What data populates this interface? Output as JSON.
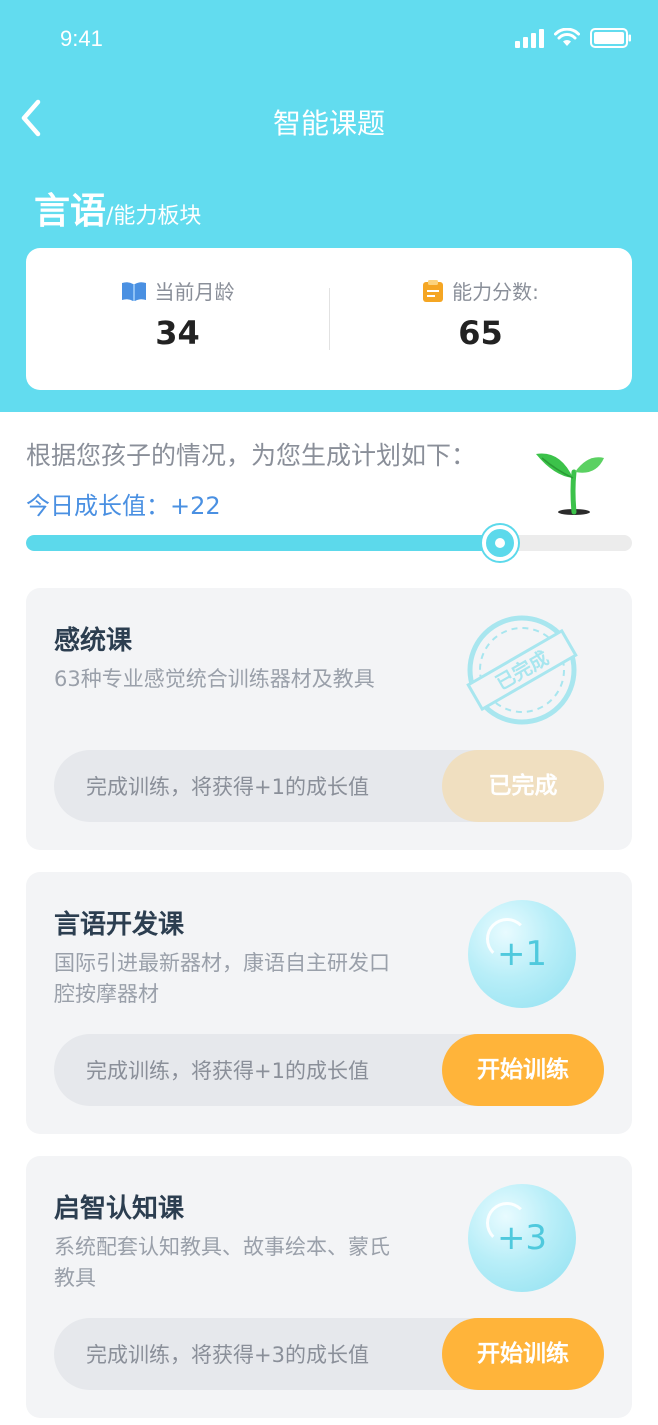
{
  "status": {
    "time": "9:41"
  },
  "nav": {
    "title": "智能课题"
  },
  "section": {
    "name": "言语",
    "suffix": "/能力板块"
  },
  "info": {
    "age_label": "当前月龄",
    "age_value": "34",
    "score_label": "能力分数:",
    "score_value": "65"
  },
  "plan": {
    "intro": "根据您孩子的情况，为您生成计划如下：",
    "growth_label": "今日成长值：+22",
    "progress": 0.8
  },
  "courses": [
    {
      "title": "感统课",
      "desc": "63种专业感觉统合训练器材及教具",
      "bar_text": "完成训练，将获得+1的成长值",
      "button": "已完成",
      "status": "completed",
      "stamp_text": "已完成"
    },
    {
      "title": "言语开发课",
      "desc": "国际引进最新器材，康语自主研发口腔按摩器材",
      "bar_text": "完成训练，将获得+1的成长值",
      "button": "开始训练",
      "status": "pending",
      "bubble": "+1"
    },
    {
      "title": "启智认知课",
      "desc": "系统配套认知教具、故事绘本、蒙氏教具",
      "bar_text": "完成训练，将获得+3的成长值",
      "button": "开始训练",
      "status": "pending",
      "bubble": "+3"
    }
  ],
  "colors": {
    "header": "#62dcef",
    "accent_blue": "#4a90e2",
    "start_button": "#ffb43a",
    "done_button": "#f0dfc0"
  }
}
